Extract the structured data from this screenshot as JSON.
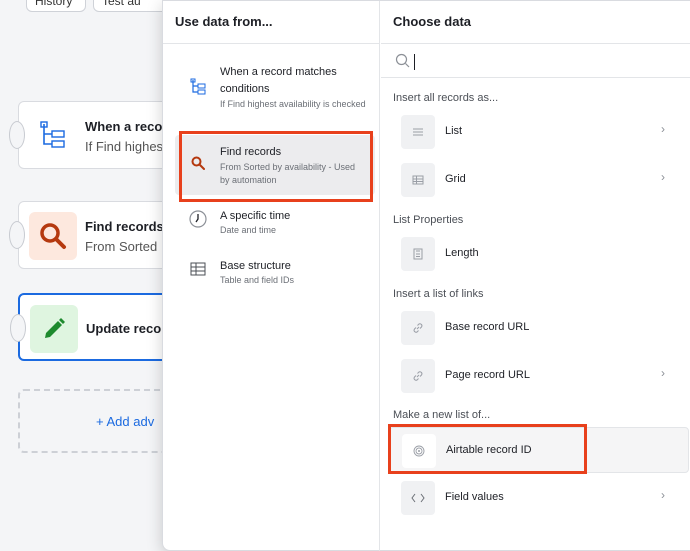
{
  "toolbar": {
    "history_label": "History",
    "test_label": "Test au"
  },
  "canvas": {
    "nodes": [
      {
        "title": "When a reco",
        "subtitle": "If Find highes",
        "icon": "tree-icon"
      },
      {
        "title": "Find records",
        "subtitle": "From Sorted",
        "icon": "search-icon"
      },
      {
        "title": "Update reco",
        "subtitle": "",
        "icon": "pencil-icon"
      }
    ],
    "add_label": "+ Add adv"
  },
  "left_panel": {
    "header": "Use data from...",
    "sources": [
      {
        "title": "When a record matches conditions",
        "subtitle": "If Find highest availability is checked",
        "icon": "tree-icon"
      },
      {
        "title": "Find records",
        "subtitle": "From Sorted by availability - Used by automation",
        "icon": "search-icon"
      },
      {
        "title": "A specific time",
        "subtitle": "Date and time",
        "icon": "clock-icon"
      },
      {
        "title": "Base structure",
        "subtitle": "Table and field IDs",
        "icon": "table-icon"
      }
    ]
  },
  "right_panel": {
    "header": "Choose data",
    "search": {
      "value": "",
      "placeholder": ""
    },
    "sections": {
      "insert_all": "Insert all records as...",
      "list_props": "List Properties",
      "insert_links": "Insert a list of links",
      "new_list": "Make a new list of..."
    },
    "options": {
      "list": "List",
      "grid": "Grid",
      "length": "Length",
      "base_url": "Base record URL",
      "page_url": "Page record URL",
      "record_id": "Airtable record ID",
      "field_values": "Field values"
    }
  },
  "colors": {
    "accent": "#1b6ae0",
    "highlight": "#e8401c",
    "find_icon_bg": "#fde8de",
    "update_icon_bg": "#dff5e0"
  }
}
